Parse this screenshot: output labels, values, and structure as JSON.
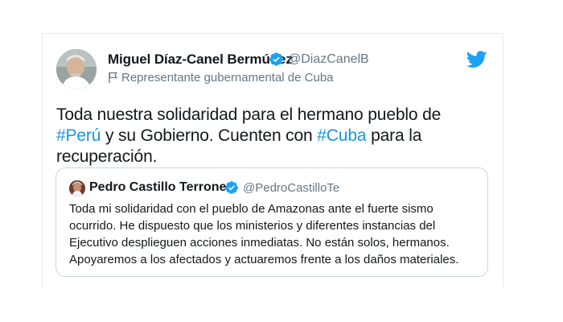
{
  "tweet": {
    "author_name": "Miguel Díaz-Canel Bermúdez",
    "handle": "@DiazCanelB",
    "label": "Representante gubernamental de Cuba",
    "text_parts": [
      "Toda nuestra solidaridad para el hermano pueblo de ",
      "#Perú",
      " y su Gobierno. Cuenten con ",
      "#Cuba",
      " para la recuperación."
    ],
    "verified_icon": "verified-badge-icon",
    "brand_icon": "twitter-bird-icon"
  },
  "quoted_tweet": {
    "author_name": "Pedro Castillo Terrones",
    "handle": "@PedroCastilloTe",
    "text_lines": [
      "Toda mi solidaridad con el pueblo de Amazonas ante el fuerte sismo",
      "ocurrido. He dispuesto que los ministerios y diferentes instancias del",
      "Ejecutivo desplieguen acciones inmediatas. No están solos, hermanos.",
      "Apoyaremos a los afectados y actuaremos frente a los daños materiales."
    ]
  },
  "colors": {
    "text": "#14171a",
    "secondary": "#657786",
    "hashtag": "#1b95e0",
    "twitter_blue": "#1da1f2",
    "border": "#ccd6dd"
  }
}
